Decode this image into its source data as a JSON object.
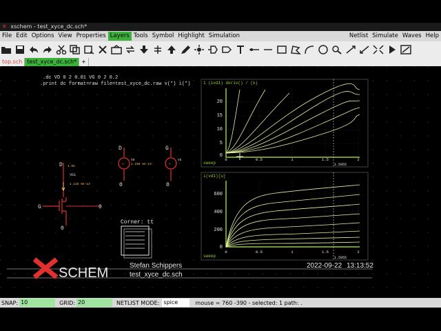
{
  "window": {
    "title": "xschem - test_xyce_dc.sch*"
  },
  "menu": {
    "left": [
      "File",
      "Edit",
      "Options",
      "View",
      "Properties",
      "Layers",
      "Tools",
      "Symbol",
      "Highlight",
      "Simulation"
    ],
    "active": "Layers",
    "right": [
      "Netlist",
      "Simulate",
      "Waves",
      "Help"
    ]
  },
  "toolbar_icons": [
    "open-icon",
    "save-icon",
    "undo-icon",
    "redo-icon",
    "cut-icon",
    "copy-icon",
    "delete-icon",
    "insert-icon",
    "rotate-icon",
    "place-symbol-icon",
    "up-icon",
    "line-icon",
    "highlight-icon",
    "pin-icon",
    "net-label-icon",
    "text-icon",
    "wire-icon",
    "rect-icon",
    "polygon-icon",
    "arc-icon",
    "circle-icon",
    "zoom-icon",
    "zoom-in-icon",
    "zoom-out-icon",
    "zoom-full-icon",
    "descend-icon",
    "back-icon"
  ],
  "tabs": [
    {
      "label": "top.sch",
      "active": false
    },
    {
      "label": "test_xyce_dc.sch*",
      "active": true
    },
    {
      "label": "+",
      "active": false
    }
  ],
  "schematic": {
    "command1": ".dc VD 0 2 0.01 VG 0 2 0.2",
    "command2": ".print dc format=raw file=test_xyce_dc.raw v(*) i(*)",
    "corner": "Corner: tt",
    "author": "Stefan Schippers",
    "filename": "test_xyce_dc.sch",
    "date": "2022-09-22",
    "time": "13:13:52",
    "logo_text": "SCHEM",
    "nodes": {
      "d": "D",
      "g": "G",
      "zero": "0"
    },
    "labels": {
      "vd1": "VD1",
      "vd": "VD",
      "vg": "VG",
      "val1": "1.116 5e-13",
      "val2": "1.104 5e-13",
      "val3": "1.55"
    }
  },
  "plot1": {
    "title": "1 (ivd1) deriv() / (k)",
    "sweep": "sweep",
    "xticks": [
      "0",
      "0.5",
      "1",
      "1.5",
      "2"
    ],
    "yticks": [
      "0",
      "5",
      "10",
      "15",
      "20"
    ],
    "cursor": "1.5955"
  },
  "plot2": {
    "title": "i(vd1)[u]",
    "sweep": "sweep",
    "xticks": [
      "0",
      "0.5",
      "1",
      "1.5",
      "2"
    ],
    "yticks": [
      "0",
      "200",
      "400",
      "600"
    ],
    "cursor": "1.5955"
  },
  "status": {
    "snap_label": "SNAP:",
    "snap": "10",
    "grid_label": "GRID:",
    "grid": "20",
    "mode_label": "NETLIST MODE:",
    "mode": "spice",
    "info": "mouse = 760 -390 - selected: 1 path: ."
  },
  "colors": {
    "menu_active": "#3bb13b",
    "wave": "#e6f2a0",
    "accent_red": "#e03030",
    "status_green": "#9fe49f"
  }
}
